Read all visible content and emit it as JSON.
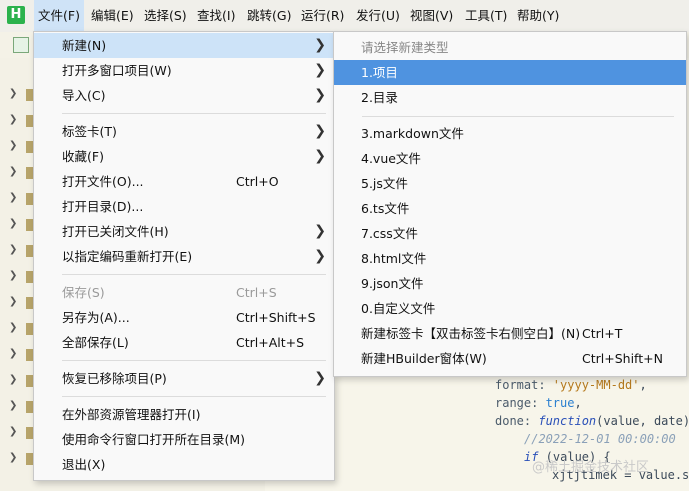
{
  "app": {
    "logo_letter": "H"
  },
  "menubar": {
    "items": [
      "文件(F)",
      "编辑(E)",
      "选择(S)",
      "查找(I)",
      "跳转(G)",
      "运行(R)",
      "发行(U)",
      "视图(V)",
      "工具(T)",
      "帮助(Y)"
    ]
  },
  "file_menu": {
    "items": [
      {
        "label": "新建(N)",
        "submenu": true
      },
      {
        "label": "打开多窗口项目(W)",
        "submenu": true
      },
      {
        "label": "导入(C)",
        "submenu": true
      },
      {
        "label": "标签卡(T)",
        "submenu": true
      },
      {
        "label": "收藏(F)",
        "submenu": true
      },
      {
        "label": "打开文件(O)...",
        "shortcut": "Ctrl+O"
      },
      {
        "label": "打开目录(D)..."
      },
      {
        "label": "打开已关闭文件(H)",
        "submenu": true
      },
      {
        "label": "以指定编码重新打开(E)",
        "submenu": true
      },
      {
        "label": "保存(S)",
        "shortcut": "Ctrl+S",
        "disabled": true
      },
      {
        "label": "另存为(A)...",
        "shortcut": "Ctrl+Shift+S"
      },
      {
        "label": "全部保存(L)",
        "shortcut": "Ctrl+Alt+S"
      },
      {
        "label": "恢复已移除项目(P)",
        "submenu": true
      },
      {
        "label": "在外部资源管理器打开(I)"
      },
      {
        "label": "使用命令行窗口打开所在目录(M)"
      },
      {
        "label": "退出(X)"
      }
    ]
  },
  "new_submenu": {
    "header": "请选择新建类型",
    "items": [
      {
        "label": "1.项目"
      },
      {
        "label": "2.目录"
      },
      {
        "label": "3.markdown文件"
      },
      {
        "label": "4.vue文件"
      },
      {
        "label": "5.js文件"
      },
      {
        "label": "6.ts文件"
      },
      {
        "label": "7.css文件"
      },
      {
        "label": "8.html文件"
      },
      {
        "label": "9.json文件"
      },
      {
        "label": "0.自定义文件"
      },
      {
        "label": "新建标签卡【双击标签卡右侧空白】(N)",
        "shortcut": "Ctrl+T"
      },
      {
        "label": "新建HBuilder窗体(W)",
        "shortcut": "Ctrl+Shift+N"
      }
    ]
  },
  "code": {
    "l1_key": "format: ",
    "l1_val": "'yyyy-MM-dd'",
    "l1_end": ",",
    "l2_key": "range: ",
    "l2_val": "true",
    "l2_end": ",",
    "l3_key": "done: ",
    "l3_kw": "function",
    "l3_rest": "(value, date)",
    "l4": "//2022-12-01 00:00:00",
    "l5_kw": "if",
    "l5_rest": " (value) {",
    "l6": "xjtjtimek = value.su"
  },
  "watermark": "@稀土掘金技术社区",
  "colors": {
    "highlight": "#4f93e0",
    "hover": "#cde3f8",
    "logo": "#2bb24c"
  }
}
